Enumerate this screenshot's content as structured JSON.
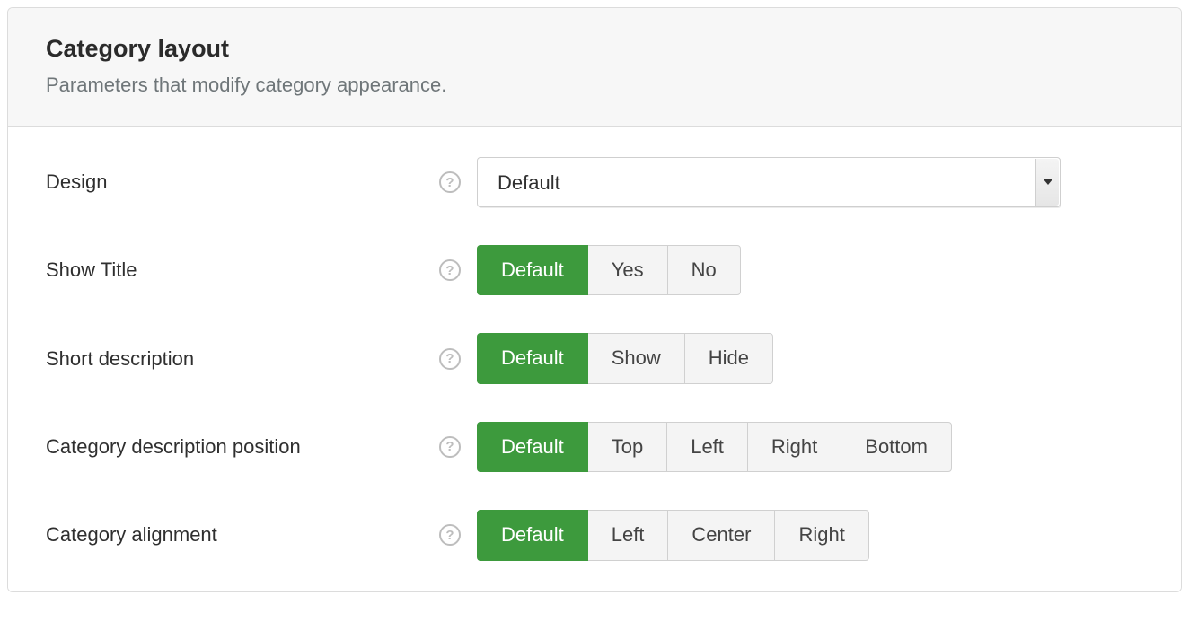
{
  "panel": {
    "title": "Category layout",
    "subtitle": "Parameters that modify category appearance."
  },
  "rows": {
    "design": {
      "label": "Design",
      "selected": "Default"
    },
    "show_title": {
      "label": "Show Title",
      "options": [
        "Default",
        "Yes",
        "No"
      ],
      "active_index": 0
    },
    "short_description": {
      "label": "Short description",
      "options": [
        "Default",
        "Show",
        "Hide"
      ],
      "active_index": 0
    },
    "cat_desc_position": {
      "label": "Category description position",
      "options": [
        "Default",
        "Top",
        "Left",
        "Right",
        "Bottom"
      ],
      "active_index": 0
    },
    "cat_alignment": {
      "label": "Category alignment",
      "options": [
        "Default",
        "Left",
        "Center",
        "Right"
      ],
      "active_index": 0
    }
  }
}
